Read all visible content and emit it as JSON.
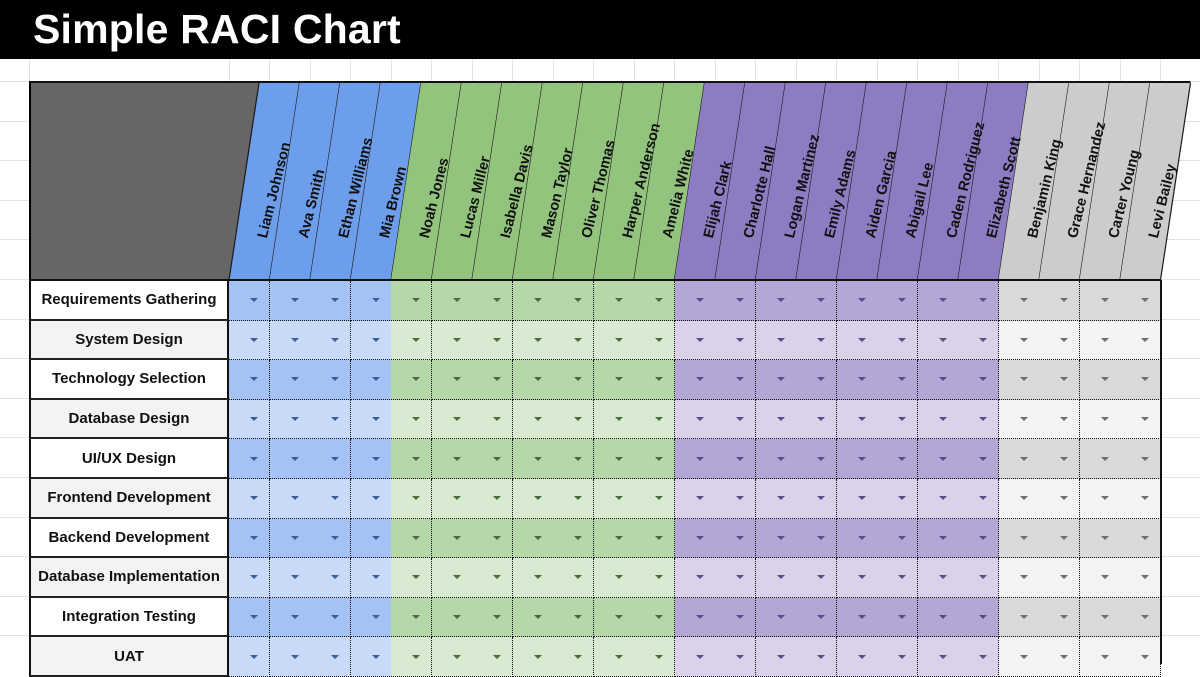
{
  "title": "Simple RACI Chart",
  "groups": [
    {
      "name": "blue",
      "header_color": "#6d9eeb",
      "dark_row": "#a4c2f4",
      "light_row": "#c9daf8",
      "arrow": "#3c5d9c",
      "people": [
        "Liam Johnson",
        "Ava Smith",
        "Ethan Williams",
        "Mia Brown"
      ]
    },
    {
      "name": "green",
      "header_color": "#93c47d",
      "dark_row": "#b6d7a8",
      "light_row": "#d9ead3",
      "arrow": "#4a6b3c",
      "people": [
        "Noah Jones",
        "Lucas Miller",
        "Isabella Davis",
        "Mason Taylor",
        "Oliver Thomas",
        "Harper Anderson",
        "Amelia White"
      ]
    },
    {
      "name": "purple",
      "header_color": "#8e7cc3",
      "dark_row": "#b4a7d6",
      "light_row": "#d9d2e9",
      "arrow": "#5b4b8a",
      "people": [
        "Elijah Clark",
        "Charlotte Hall",
        "Logan Martinez",
        "Emily Adams",
        "Aiden Garcia",
        "Abigail Lee",
        "Caden Rodriguez",
        "Elizabeth Scott"
      ]
    },
    {
      "name": "gray",
      "header_color": "#cccccc",
      "dark_row": "#d9d9d9",
      "light_row": "#f3f3f3",
      "arrow": "#6e6e6e",
      "people": [
        "Benjamin King",
        "Grace Hernandez",
        "Carter Young",
        "Levi Bailey"
      ]
    }
  ],
  "tasks": [
    "Requirements Gathering",
    "System Design",
    "Technology Selection",
    "Database Design",
    "UI/UX Design",
    "Frontend Development",
    "Backend Development",
    "Database Implementation",
    "Integration Testing",
    "UAT"
  ],
  "cell_value": "",
  "header_corner_color": "#666666",
  "title_bar_color": "#000000"
}
